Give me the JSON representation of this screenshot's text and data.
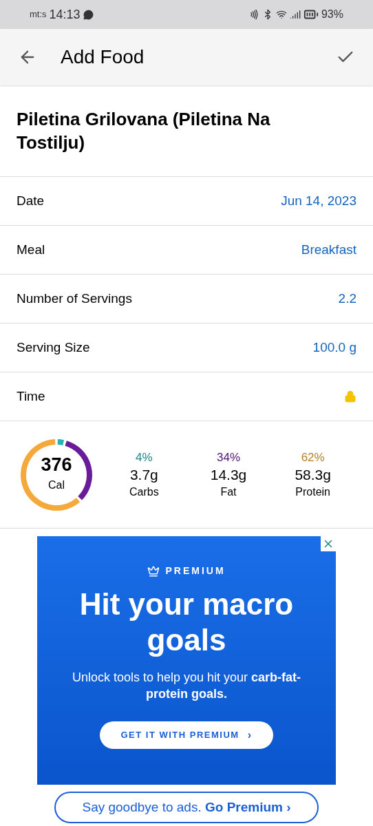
{
  "status_bar": {
    "carrier": "mt:s",
    "time": "14:13",
    "battery": "93%"
  },
  "header": {
    "title": "Add Food"
  },
  "food": {
    "name": "Piletina Grilovana (Piletina Na Tostilju)"
  },
  "fields": [
    {
      "kind": "value",
      "label": "Date",
      "value": "Jun 14, 2023"
    },
    {
      "kind": "value",
      "label": "Meal",
      "value": "Breakfast"
    },
    {
      "kind": "value",
      "label": "Number of Servings",
      "value": "2.2"
    },
    {
      "kind": "value",
      "label": "Serving Size",
      "value": "100.0 g"
    },
    {
      "kind": "locked",
      "label": "Time"
    }
  ],
  "summary": {
    "calories": "376",
    "calories_label": "Cal",
    "macros": [
      {
        "percent": "4%",
        "amount": "3.7g",
        "name": "Carbs",
        "color": "#2bb3b1"
      },
      {
        "percent": "34%",
        "amount": "14.3g",
        "name": "Fat",
        "color": "#6a1b9a"
      },
      {
        "percent": "62%",
        "amount": "58.3g",
        "name": "Protein",
        "color": "#f5a93b"
      }
    ]
  },
  "ad": {
    "eyebrow": "PREMIUM",
    "headline": "Hit your macro goals",
    "body": "Unlock tools to help you hit your **carb-fat-protein goals.**",
    "cta": "GET IT WITH PREMIUM",
    "cta_chevron": "›"
  },
  "premium_button": "Say goodbye to ads. **Go Premium ›**"
}
